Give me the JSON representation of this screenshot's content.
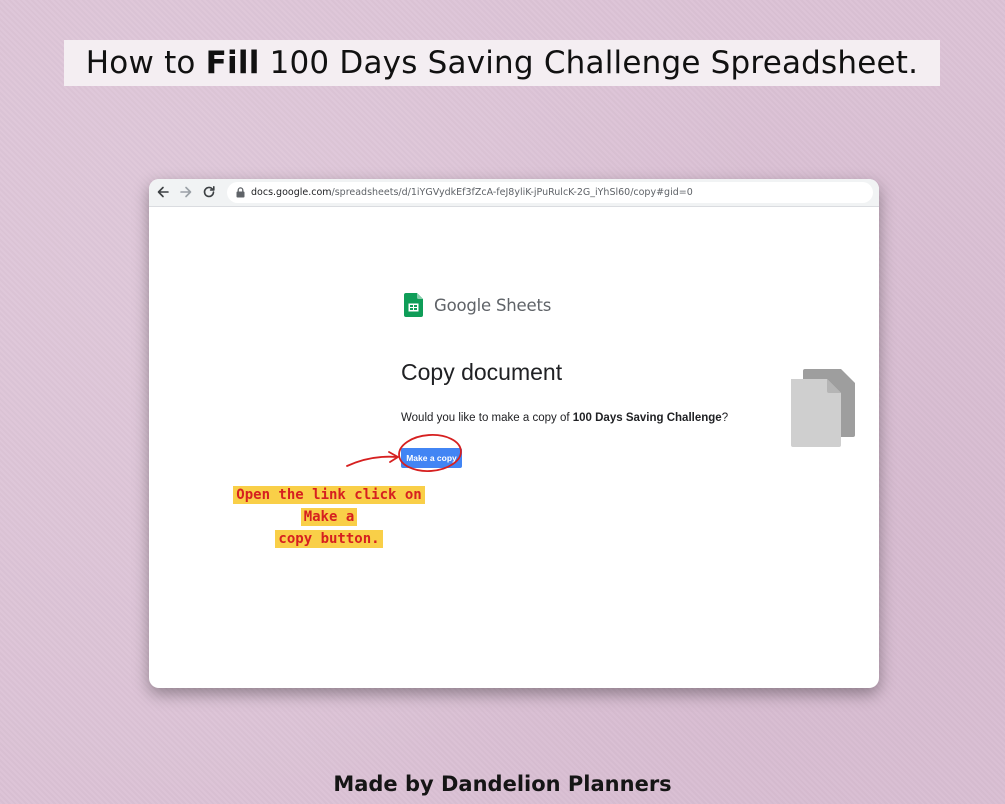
{
  "headline": {
    "prefix": "How to ",
    "bold": "Fill",
    "suffix": " 100 Days Saving Challenge Spreadsheet."
  },
  "browser": {
    "url_host": "docs.google.com",
    "url_path": "/spreadsheets/d/1iYGVydkEf3fZcA-feJ8yliK-jPuRulcK-2G_iYhSl60/copy#gid=0"
  },
  "page": {
    "brand_name": "Google Sheets",
    "title": "Copy document",
    "question_prefix": "Would you like to make a copy of ",
    "question_doc_name": "100 Days Saving Challenge",
    "question_suffix": "?",
    "button_label": "Make a copy"
  },
  "callout": {
    "line1": "Open the link click on Make a",
    "line2": "copy button."
  },
  "footer": {
    "credit": "Made by Dandelion Planners"
  },
  "colors": {
    "button_blue": "#4285f4",
    "annotation_red": "#d62020",
    "highlight_yellow": "#f9cf48",
    "sheets_green": "#0f9d58"
  }
}
